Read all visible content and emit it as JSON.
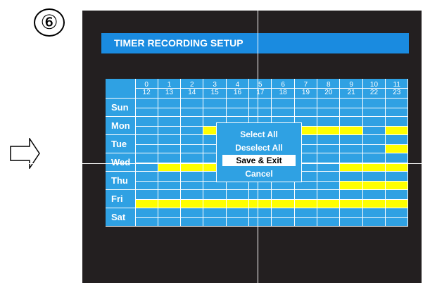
{
  "step_number": "⑥",
  "title": "TIMER RECORDING SETUP",
  "hours_top": [
    "0",
    "1",
    "2",
    "3",
    "4",
    "5",
    "6",
    "7",
    "8",
    "9",
    "10",
    "11"
  ],
  "hours_bottom": [
    "12",
    "13",
    "14",
    "15",
    "16",
    "17",
    "18",
    "19",
    "20",
    "21",
    "22",
    "23"
  ],
  "days": [
    "Sun",
    "Mon",
    "Tue",
    "Wed",
    "Thu",
    "Fri",
    "Sat"
  ],
  "menu": {
    "items": [
      "Select All",
      "Deselect All",
      "Save & Exit",
      "Cancel"
    ],
    "selected_index": 2
  },
  "colors": {
    "screen_bg": "#231f20",
    "grid_bg": "#2fa1e3",
    "recording": "#ffff00",
    "title_bar": "#1a8be0",
    "selection": "#ffffff"
  },
  "icons": [
    "arrow-right-icon"
  ]
}
